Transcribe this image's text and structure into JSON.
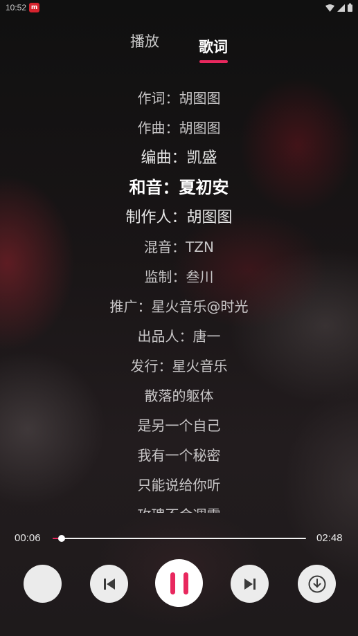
{
  "status_bar": {
    "time": "10:52",
    "app_badge": "m"
  },
  "tabs": [
    {
      "label": "播放",
      "active": false
    },
    {
      "label": "歌词",
      "active": true
    }
  ],
  "accent_color": "#e8285e",
  "lyrics": [
    "作词：胡图图",
    "作曲：胡图图",
    "编曲：凯盛",
    "和音：夏初安",
    "制作人：胡图图",
    "混音：TZN",
    "监制：叁川",
    "推广：星火音乐@时光",
    "出品人：唐一",
    "发行：星火音乐",
    "散落的躯体",
    "是另一个自己",
    "我有一个秘密",
    "只能说给你听",
    "玫瑰不会凋零"
  ],
  "active_lyric_index": 3,
  "player": {
    "current_time": "00:06",
    "total_time": "02:48",
    "progress": 0.036,
    "state": "playing"
  },
  "controls": {
    "prev_icon": "skip-previous-icon",
    "play_icon": "pause-icon",
    "next_icon": "skip-next-icon",
    "download_icon": "download-icon"
  }
}
